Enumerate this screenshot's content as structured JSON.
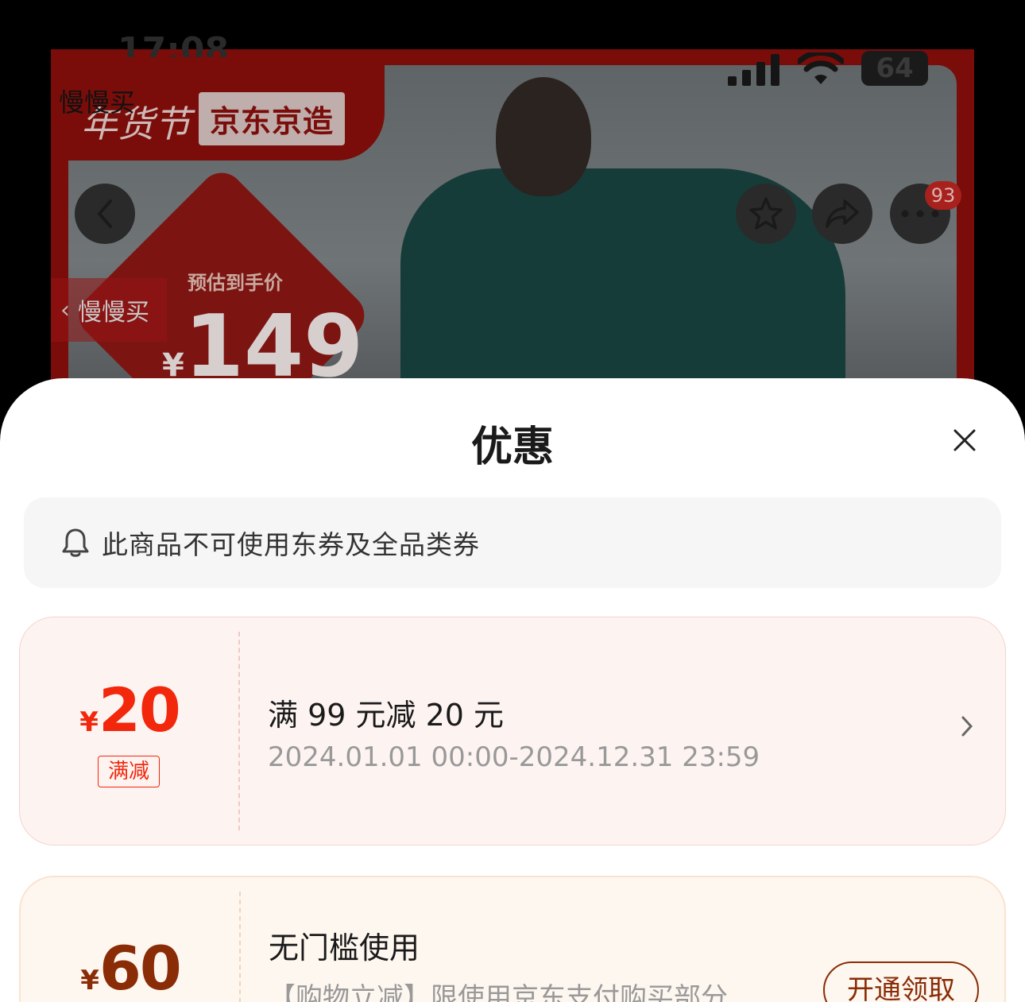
{
  "status_bar": {
    "time": "17:08",
    "page_title": "慢慢买",
    "battery": "64"
  },
  "banner": {
    "festival_text": "年货节",
    "brand_badge": "京东京造",
    "price_label": "预估到手价",
    "price": "149",
    "price_currency": "¥",
    "back_app_label": "慢慢买",
    "more_badge_count": "93"
  },
  "sheet": {
    "title": "优惠",
    "notice": "此商品不可使用东券及全品类券",
    "coupons": [
      {
        "currency": "¥",
        "amount": "20",
        "tag": "满减",
        "title": "满 99 元减 20 元",
        "subtitle": "2024.01.01 00:00-2024.12.31 23:59",
        "accent": "#f2270c"
      },
      {
        "currency": "¥",
        "amount": "60",
        "title": "无门槛使用",
        "subtitle": "【购物立减】限使用京东支付购买部分...",
        "button": "开通领取",
        "accent": "#8a2c06"
      }
    ]
  }
}
